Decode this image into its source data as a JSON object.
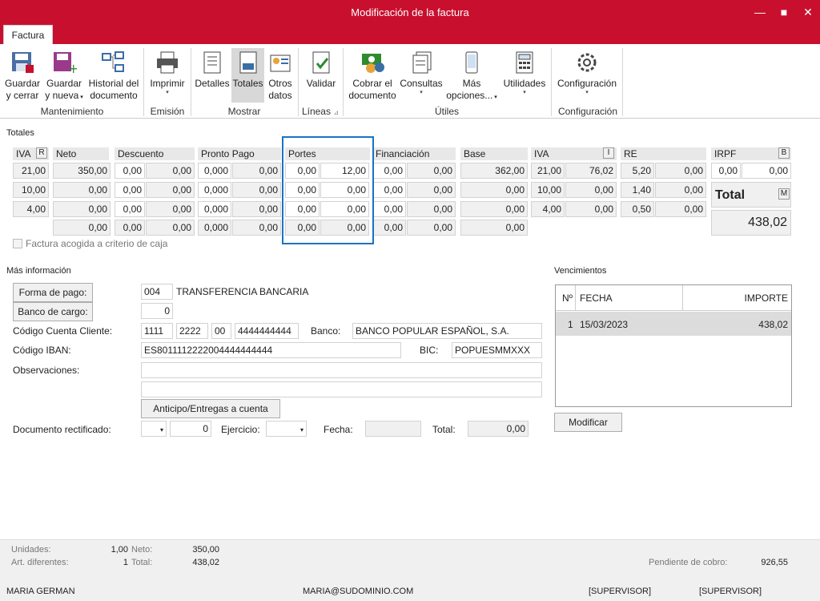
{
  "window": {
    "title": "Modificación de la factura",
    "tab": "Factura"
  },
  "ribbon": {
    "guardar_cerrar": "Guardar\ny cerrar",
    "guardar_nueva": "Guardar\ny nueva",
    "historial": "Historial del\ndocumento",
    "imprimir": "Imprimir",
    "detalles": "Detalles",
    "totales": "Totales",
    "otros_datos": "Otros\ndatos",
    "validar": "Validar",
    "cobrar": "Cobrar el\ndocumento",
    "consultas": "Consultas",
    "mas_opciones": "Más\nopciones...",
    "utilidades": "Utilidades",
    "configuracion": "Configuración",
    "groups": {
      "mantenimiento": "Mantenimiento",
      "emision": "Emisión",
      "mostrar": "Mostrar",
      "lineas": "Líneas",
      "utiles": "Útiles",
      "configuracion": "Configuración"
    }
  },
  "totales": {
    "section": "Totales",
    "headers": {
      "iva": "IVA",
      "iva_btn": "R",
      "neto": "Neto",
      "descuento": "Descuento",
      "pronto": "Pronto Pago",
      "portes": "Portes",
      "financiacion": "Financiación",
      "base": "Base",
      "iva2": "IVA",
      "iva2_btn": "I",
      "re": "RE",
      "irpf": "IRPF",
      "irpf_btn": "B"
    },
    "rows": [
      {
        "iva": "21,00",
        "neto": "350,00",
        "d1": "0,00",
        "d2": "0,00",
        "p1": "0,000",
        "p2": "0,00",
        "po1": "0,00",
        "po2": "12,00",
        "f1": "0,00",
        "f2": "0,00",
        "base": "362,00",
        "i1": "21,00",
        "i2": "76,02",
        "r1": "5,20",
        "r2": "0,00"
      },
      {
        "iva": "10,00",
        "neto": "0,00",
        "d1": "0,00",
        "d2": "0,00",
        "p1": "0,000",
        "p2": "0,00",
        "po1": "0,00",
        "po2": "0,00",
        "f1": "0,00",
        "f2": "0,00",
        "base": "0,00",
        "i1": "10,00",
        "i2": "0,00",
        "r1": "1,40",
        "r2": "0,00"
      },
      {
        "iva": "4,00",
        "neto": "0,00",
        "d1": "0,00",
        "d2": "0,00",
        "p1": "0,000",
        "p2": "0,00",
        "po1": "0,00",
        "po2": "0,00",
        "f1": "0,00",
        "f2": "0,00",
        "base": "0,00",
        "i1": "4,00",
        "i2": "0,00",
        "r1": "0,50",
        "r2": "0,00"
      },
      {
        "iva": "",
        "neto": "0,00",
        "d1": "0,00",
        "d2": "0,00",
        "p1": "0,000",
        "p2": "0,00",
        "po1": "0,00",
        "po2": "0,00",
        "f1": "0,00",
        "f2": "0,00",
        "base": "0,00"
      }
    ],
    "irpf1": "0,00",
    "irpf2": "0,00",
    "total_label": "Total",
    "total_btn": "M",
    "total_value": "438,02",
    "criterio_caja": "Factura acogida a criterio de caja"
  },
  "info": {
    "section": "Más información",
    "forma_pago_btn": "Forma de pago:",
    "forma_pago_code": "004",
    "forma_pago_desc": "TRANSFERENCIA BANCARIA",
    "banco_cargo_btn": "Banco de cargo:",
    "banco_cargo_val": "0",
    "ccc_label": "Código Cuenta Cliente:",
    "ccc1": "1111",
    "ccc2": "2222",
    "ccc3": "00",
    "ccc4": "4444444444",
    "banco_label": "Banco:",
    "banco_val": "BANCO POPULAR ESPAÑOL, S.A.",
    "iban_label": "Código IBAN:",
    "iban_val": "ES8011112222004444444444",
    "bic_label": "BIC:",
    "bic_val": "POPUESMMXXX",
    "obs_label": "Observaciones:",
    "anticipo_btn": "Anticipo/Entregas a cuenta",
    "docrect_label": "Documento rectificado:",
    "docrect_num": "0",
    "ejercicio_label": "Ejercicio:",
    "fecha_label": "Fecha:",
    "total_label": "Total:",
    "total_val": "0,00"
  },
  "venc": {
    "section": "Vencimientos",
    "col_n": "Nº",
    "col_fecha": "FECHA",
    "col_importe": "IMPORTE",
    "rows": [
      {
        "n": "1",
        "fecha": "15/03/2023",
        "importe": "438,02"
      }
    ],
    "modificar": "Modificar"
  },
  "status": {
    "unidades_l": "Unidades:",
    "unidades_v": "1,00",
    "neto_l": "Neto:",
    "neto_v": "350,00",
    "art_l": "Art. diferentes:",
    "art_v": "1",
    "total_l": "Total:",
    "total_v": "438,02",
    "pendiente_l": "Pendiente de cobro:",
    "pendiente_v": "926,55",
    "user": "MARIA GERMAN",
    "email": "MARIA@SUDOMINIO.COM",
    "sup1": "[SUPERVISOR]",
    "sup2": "[SUPERVISOR]"
  },
  "colors": {
    "accent": "#c8102e",
    "highlight_box": "#1a73c2"
  },
  "icons": [
    "save-close-icon",
    "save-new-icon",
    "history-icon",
    "printer-icon",
    "details-icon",
    "totals-icon",
    "other-data-icon",
    "validate-icon",
    "cash-icon",
    "reports-icon",
    "phone-icon",
    "calculator-icon",
    "gear-icon"
  ]
}
